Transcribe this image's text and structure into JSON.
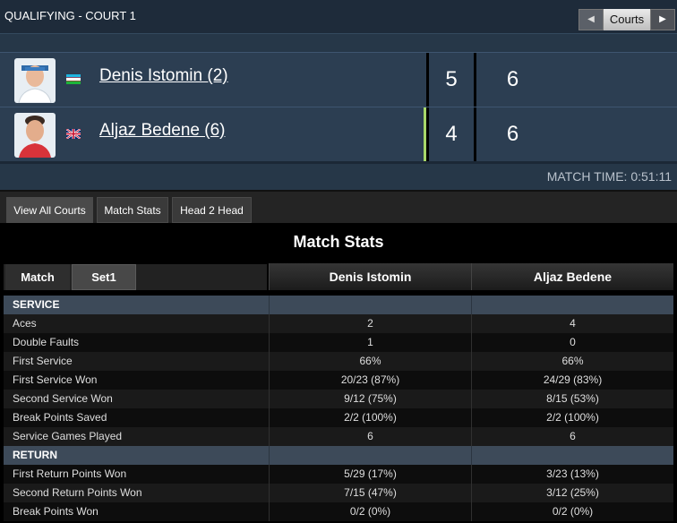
{
  "header": {
    "court_title": "QUALIFYING - COURT 1",
    "courts_label": "Courts",
    "prev_icon": "triangle-left-icon",
    "next_icon": "triangle-right-icon"
  },
  "players": [
    {
      "name": "Denis Istomin (2)",
      "flag": "uzbekistan-flag-icon",
      "sets": [
        "5",
        "6"
      ],
      "serving": false
    },
    {
      "name": "Aljaz Bedene (6)",
      "flag": "great-britain-flag-icon",
      "sets": [
        "4",
        "6"
      ],
      "serving": true
    }
  ],
  "match_time": "MATCH TIME: 0:51:11",
  "tabs": [
    "View All Courts",
    "Match Stats",
    "Head 2 Head"
  ],
  "stats": {
    "title": "Match Stats",
    "period_tabs": [
      "Match",
      "Set1"
    ],
    "columns": [
      "Denis Istomin",
      "Aljaz Bedene"
    ],
    "sections": [
      {
        "name": "SERVICE",
        "rows": [
          [
            "Aces",
            "2",
            "4"
          ],
          [
            "Double Faults",
            "1",
            "0"
          ],
          [
            "First Service",
            "66%",
            "66%"
          ],
          [
            "First Service Won",
            "20/23 (87%)",
            "24/29 (83%)"
          ],
          [
            "Second Service Won",
            "9/12 (75%)",
            "8/15 (53%)"
          ],
          [
            "Break Points Saved",
            "2/2 (100%)",
            "2/2 (100%)"
          ],
          [
            "Service Games Played",
            "6",
            "6"
          ]
        ]
      },
      {
        "name": "RETURN",
        "rows": [
          [
            "First Return Points Won",
            "5/29 (17%)",
            "3/23 (13%)"
          ],
          [
            "Second Return Points Won",
            "7/15 (47%)",
            "3/12 (25%)"
          ],
          [
            "Break Points Won",
            "0/2 (0%)",
            "0/2 (0%)"
          ]
        ]
      }
    ]
  },
  "colors": {
    "header_bg": "#1e2b3a",
    "score_bg": "#2c3e52",
    "serve_indicator": "#a8d86a",
    "section_bg": "#3d4a59"
  }
}
